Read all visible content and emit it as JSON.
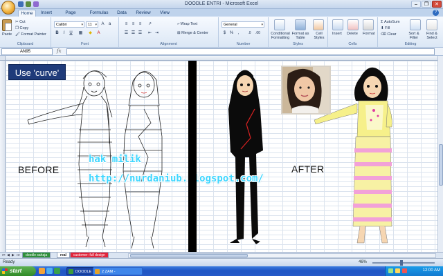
{
  "window": {
    "title": "DOODLE ENTRI - Microsoft Excel",
    "controls": [
      "–",
      "❐",
      "✕"
    ]
  },
  "ribbon": {
    "tabs": [
      "Home",
      "Insert",
      "Page Layout",
      "Formulas",
      "Data",
      "Review",
      "View"
    ],
    "active_tab": "Home",
    "clipboard": {
      "paste": "Paste",
      "cut": "Cut",
      "copy": "Copy",
      "format_painter": "Format Painter",
      "label": "Clipboard"
    },
    "font": {
      "name": "Calibri",
      "size": "11",
      "label": "Font"
    },
    "alignment": {
      "wrap": "Wrap Text",
      "merge": "Merge & Center",
      "label": "Alignment"
    },
    "number": {
      "format": "General",
      "label": "Number"
    },
    "styles": {
      "cond": "Conditional Formatting",
      "table": "Format as Table",
      "cell": "Cell Styles",
      "label": "Styles"
    },
    "cells": {
      "insert": "Insert",
      "delete": "Delete",
      "format": "Format",
      "label": "Cells"
    },
    "editing": {
      "autosum": "AutoSum",
      "fill": "Fill",
      "clear": "Clear",
      "sort": "Sort & Filter",
      "find": "Find & Select",
      "label": "Editing"
    }
  },
  "formula_bar": {
    "name_box": "AN95",
    "fx": "fx",
    "value": ""
  },
  "sheet": {
    "use_curve": "Use 'curve'",
    "before": "BEFORE",
    "after": "AFTER",
    "watermark_line1": "hak milik",
    "watermark_line2": "http://nurdaniub.blogspot.com/"
  },
  "sheet_tabs": [
    "doodle sahaja",
    "real",
    "customer: full design"
  ],
  "status": {
    "ready": "Ready",
    "zoom": "46%"
  },
  "taskbar": {
    "start": "start",
    "tasks": [
      "DOODLE ENTRI",
      "2 ZAM -"
    ],
    "clock": "12:00 AM"
  },
  "colors": {
    "use_curve_bg": "#1f3b7a",
    "watermark": "#3ed6ff",
    "dress_yellow": "#f6f08a",
    "skirt_pink": "#f2a1d8",
    "taskbar_blue": "#2559c8"
  }
}
